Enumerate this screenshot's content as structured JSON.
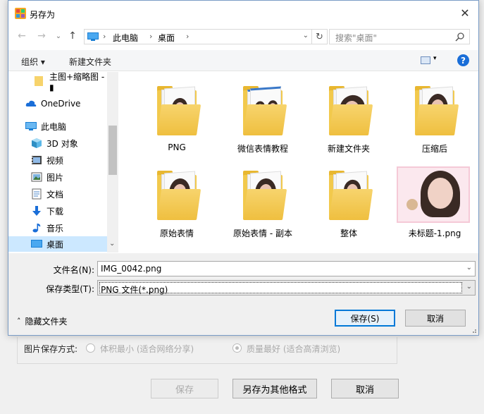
{
  "background": {
    "save_mode_label": "图片保存方式:",
    "option_small": "体积最小 (适合网络分享)",
    "option_quality": "质量最好 (适合高清浏览)",
    "save_button": "保存",
    "save_other_button": "另存为其他格式",
    "cancel_button": "取消"
  },
  "dialog": {
    "title": "另存为",
    "close_glyph": "✕",
    "nav": {
      "back_glyph": "←",
      "forward_glyph": "→",
      "recent_glyph": "⌄",
      "up_glyph": "↑",
      "breadcrumb": [
        "此电脑",
        "桌面"
      ],
      "breadcrumb_sep": "›",
      "dropdown_glyph": "⌄",
      "refresh_glyph": "↻",
      "search_placeholder": "搜索\"桌面\""
    },
    "toolbar": {
      "organize": "组织 ▾",
      "new_folder": "新建文件夹",
      "view_dropdown": "▾",
      "help": "?"
    },
    "sidebar": {
      "items": [
        {
          "label": "主图+缩略图 - ▮",
          "icon": "folder-icon"
        },
        {
          "label": "OneDrive",
          "icon": "cloud-icon"
        },
        {
          "label": "此电脑",
          "icon": "computer-icon"
        },
        {
          "label": "3D 对象",
          "icon": "cube-icon"
        },
        {
          "label": "视频",
          "icon": "video-icon"
        },
        {
          "label": "图片",
          "icon": "picture-icon"
        },
        {
          "label": "文档",
          "icon": "document-icon"
        },
        {
          "label": "下载",
          "icon": "download-icon"
        },
        {
          "label": "音乐",
          "icon": "music-icon"
        },
        {
          "label": "桌面",
          "icon": "desktop-icon"
        }
      ],
      "scroll_down_glyph": "⌄"
    },
    "files": [
      {
        "name": "PNG",
        "type": "folder"
      },
      {
        "name": "微信表情教程",
        "type": "folder"
      },
      {
        "name": "新建文件夹",
        "type": "folder"
      },
      {
        "name": "压缩后",
        "type": "folder"
      },
      {
        "name": "原始表情",
        "type": "folder"
      },
      {
        "name": "原始表情 - 副本",
        "type": "folder"
      },
      {
        "name": "整体",
        "type": "folder"
      },
      {
        "name": "未标题-1.png",
        "type": "image"
      }
    ],
    "filename_label": "文件名(N):",
    "filename_value": "IMG_0042.png",
    "filetype_label": "保存类型(T):",
    "filetype_value": "PNG 文件(*.png)",
    "combo_glyph": "⌄",
    "hide_folders": "隐藏文件夹",
    "hide_folders_glyph": "˄",
    "save_button": "保存(S)",
    "cancel_button": "取消"
  },
  "colors": {
    "accent": "#0078d7",
    "selection": "#cce8ff",
    "folder": "#f2c94c"
  }
}
